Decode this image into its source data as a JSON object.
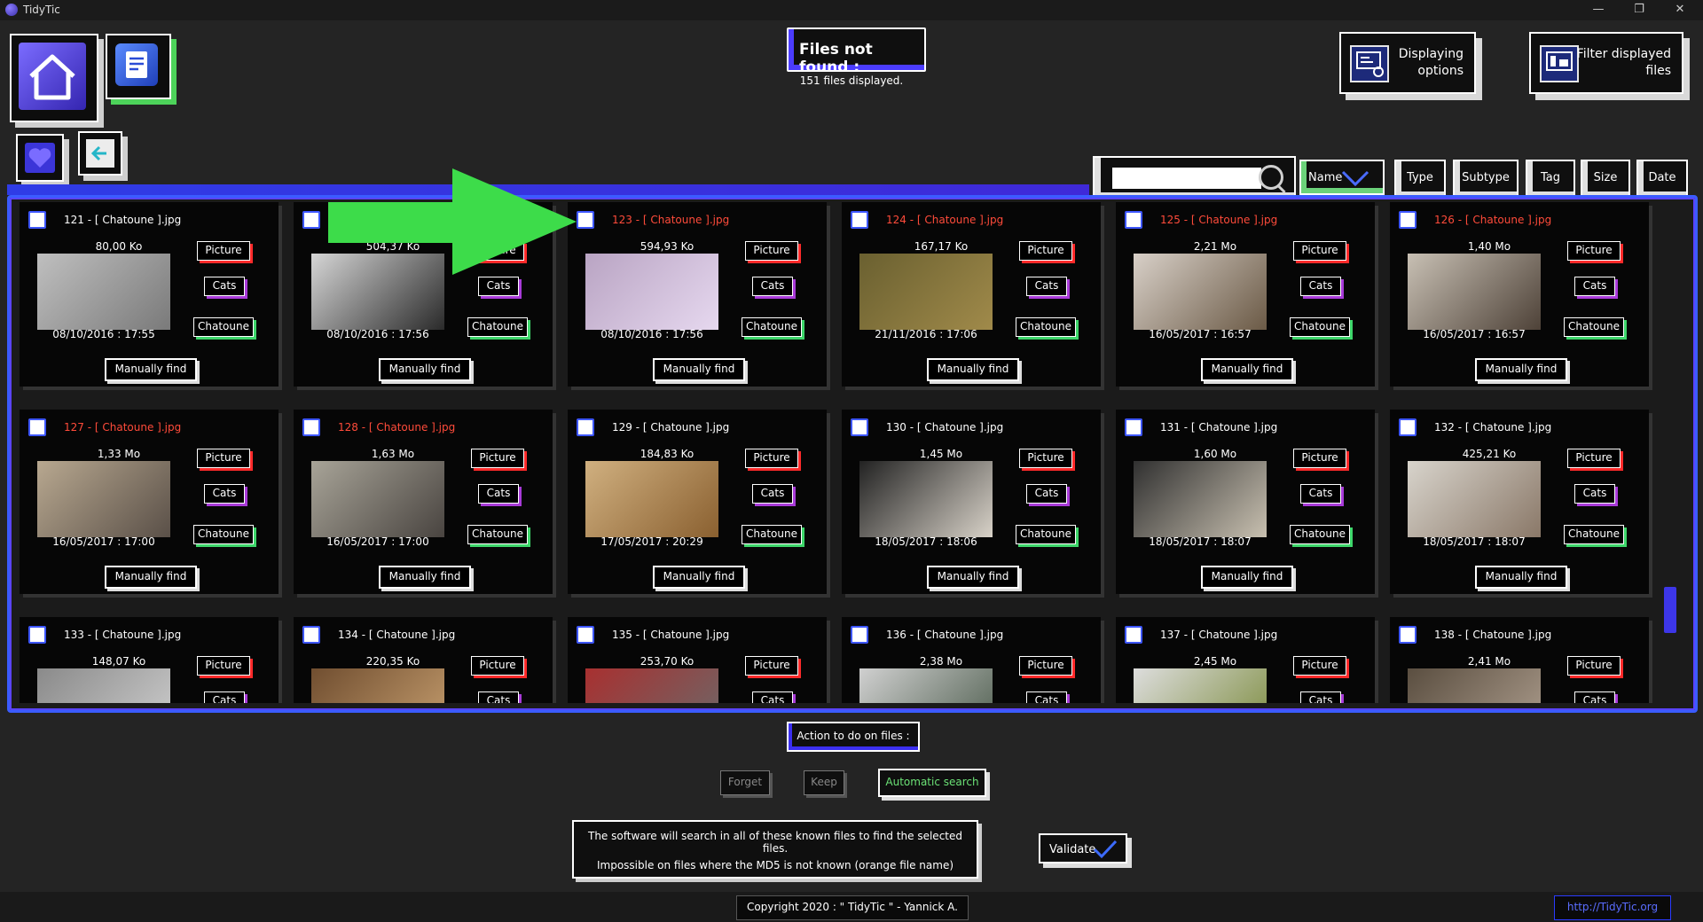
{
  "window": {
    "title": "TidyTic",
    "controls": [
      "—",
      "❐",
      "✕"
    ]
  },
  "header": {
    "title": "Files not found :",
    "subtitle": "151 files displayed.",
    "displaying_options": "Displaying options",
    "filter_displayed": "Filter displayed files"
  },
  "search": {
    "value": ""
  },
  "sort": {
    "items": [
      {
        "label": "Name"
      },
      {
        "label": "Type"
      },
      {
        "label": "Subtype"
      },
      {
        "label": "Tag"
      },
      {
        "label": "Size"
      },
      {
        "label": "Date"
      }
    ]
  },
  "cards": [
    {
      "name": "121 - [ Chatoune ].jpg",
      "orange": false,
      "size": "80,00 Ko",
      "date": "08/10/2016 : 17:55",
      "type": "Picture",
      "subtype": "Cats",
      "tag": "Chatoune",
      "action": "Manually find"
    },
    {
      "name": "122 - [ Chatoune ].jpg",
      "orange": false,
      "size": "504,37 Ko",
      "date": "08/10/2016 : 17:56",
      "type": "Picture",
      "subtype": "Cats",
      "tag": "Chatoune",
      "action": "Manually find"
    },
    {
      "name": "123 - [ Chatoune ].jpg",
      "orange": true,
      "size": "594,93 Ko",
      "date": "08/10/2016 : 17:56",
      "type": "Picture",
      "subtype": "Cats",
      "tag": "Chatoune",
      "action": "Manually find"
    },
    {
      "name": "124 - [ Chatoune ].jpg",
      "orange": true,
      "size": "167,17 Ko",
      "date": "21/11/2016 : 17:06",
      "type": "Picture",
      "subtype": "Cats",
      "tag": "Chatoune",
      "action": "Manually find"
    },
    {
      "name": "125 - [ Chatoune ].jpg",
      "orange": true,
      "size": "2,21 Mo",
      "date": "16/05/2017 : 16:57",
      "type": "Picture",
      "subtype": "Cats",
      "tag": "Chatoune",
      "action": "Manually find"
    },
    {
      "name": "126 - [ Chatoune ].jpg",
      "orange": true,
      "size": "1,40 Mo",
      "date": "16/05/2017 : 16:57",
      "type": "Picture",
      "subtype": "Cats",
      "tag": "Chatoune",
      "action": "Manually find"
    },
    {
      "name": "127 - [ Chatoune ].jpg",
      "orange": true,
      "size": "1,33 Mo",
      "date": "16/05/2017 : 17:00",
      "type": "Picture",
      "subtype": "Cats",
      "tag": "Chatoune",
      "action": "Manually find"
    },
    {
      "name": "128 - [ Chatoune ].jpg",
      "orange": true,
      "size": "1,63 Mo",
      "date": "16/05/2017 : 17:00",
      "type": "Picture",
      "subtype": "Cats",
      "tag": "Chatoune",
      "action": "Manually find"
    },
    {
      "name": "129 - [ Chatoune ].jpg",
      "orange": false,
      "size": "184,83 Ko",
      "date": "17/05/2017 : 20:29",
      "type": "Picture",
      "subtype": "Cats",
      "tag": "Chatoune",
      "action": "Manually find"
    },
    {
      "name": "130 - [ Chatoune ].jpg",
      "orange": false,
      "size": "1,45 Mo",
      "date": "18/05/2017 : 18:06",
      "type": "Picture",
      "subtype": "Cats",
      "tag": "Chatoune",
      "action": "Manually find"
    },
    {
      "name": "131 - [ Chatoune ].jpg",
      "orange": false,
      "size": "1,60 Mo",
      "date": "18/05/2017 : 18:07",
      "type": "Picture",
      "subtype": "Cats",
      "tag": "Chatoune",
      "action": "Manually find"
    },
    {
      "name": "132 - [ Chatoune ].jpg",
      "orange": false,
      "size": "425,21 Ko",
      "date": "18/05/2017 : 18:07",
      "type": "Picture",
      "subtype": "Cats",
      "tag": "Chatoune",
      "action": "Manually find"
    },
    {
      "name": "133 - [ Chatoune ].jpg",
      "orange": false,
      "size": "148,07 Ko",
      "date": "",
      "type": "Picture",
      "subtype": "Cats",
      "tag": "Chatoune",
      "action": "Manually find"
    },
    {
      "name": "134 - [ Chatoune ].jpg",
      "orange": false,
      "size": "220,35 Ko",
      "date": "",
      "type": "Picture",
      "subtype": "Cats",
      "tag": "Chatoune",
      "action": "Manually find"
    },
    {
      "name": "135 - [ Chatoune ].jpg",
      "orange": false,
      "size": "253,70 Ko",
      "date": "",
      "type": "Picture",
      "subtype": "Cats",
      "tag": "Chatoune",
      "action": "Manually find"
    },
    {
      "name": "136 - [ Chatoune ].jpg",
      "orange": false,
      "size": "2,38 Mo",
      "date": "",
      "type": "Picture",
      "subtype": "Cats",
      "tag": "Chatoune",
      "action": "Manually find"
    },
    {
      "name": "137 - [ Chatoune ].jpg",
      "orange": false,
      "size": "2,45 Mo",
      "date": "",
      "type": "Picture",
      "subtype": "Cats",
      "tag": "Chatoune",
      "action": "Manually find"
    },
    {
      "name": "138 - [ Chatoune ].jpg",
      "orange": false,
      "size": "2,41 Mo",
      "date": "",
      "type": "Picture",
      "subtype": "Cats",
      "tag": "Chatoune",
      "action": "Manually find"
    }
  ],
  "actions": {
    "title": "Action to do on files :",
    "forget": "Forget",
    "keep": "Keep",
    "auto": "Automatic search",
    "message_line1": "The software will search in all of these known files to find the selected files.",
    "message_line2": "Impossible on files where the MD5 is not known (orange file name)",
    "validate": "Validate"
  },
  "footer": {
    "copyright": "Copyright 2020 : \" TidyTic \" - Yannick A.",
    "url": "http://TidyTic.org"
  },
  "colors": {
    "accent": "#3a5cff",
    "orange_name": "#ff4b3a",
    "tag_green": "#3dd66a",
    "tag_red": "#ff2a2a",
    "tag_purple": "#a83ad8",
    "arrow": "#3ddc4a"
  }
}
